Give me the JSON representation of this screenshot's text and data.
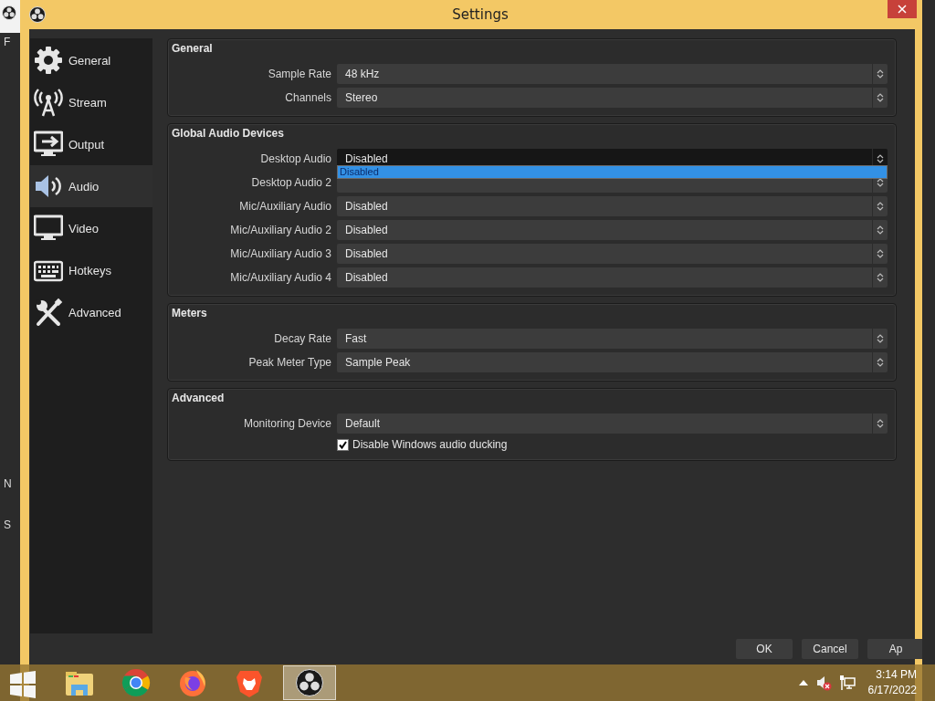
{
  "background_window": {
    "texts": [
      "F",
      "N",
      "S"
    ]
  },
  "window": {
    "title": "Settings"
  },
  "sidebar": {
    "items": [
      {
        "label": "General",
        "selected": false
      },
      {
        "label": "Stream",
        "selected": false
      },
      {
        "label": "Output",
        "selected": false
      },
      {
        "label": "Audio",
        "selected": true
      },
      {
        "label": "Video",
        "selected": false
      },
      {
        "label": "Hotkeys",
        "selected": false
      },
      {
        "label": "Advanced",
        "selected": false
      }
    ]
  },
  "groups": [
    {
      "title": "General",
      "rows": [
        {
          "kind": "combo",
          "label": "Sample Rate",
          "value": "48 kHz",
          "open": false
        },
        {
          "kind": "combo",
          "label": "Channels",
          "value": "Stereo",
          "open": false
        }
      ]
    },
    {
      "title": "Global Audio Devices",
      "rows": [
        {
          "kind": "combo",
          "label": "Desktop Audio",
          "value": "Disabled",
          "open": true,
          "options": [
            {
              "label": "Disabled",
              "selected": true
            }
          ]
        },
        {
          "kind": "combo",
          "label": "Desktop Audio 2",
          "open": false
        },
        {
          "kind": "combo",
          "label": "Mic/Auxiliary Audio",
          "value": "Disabled",
          "open": false
        },
        {
          "kind": "combo",
          "label": "Mic/Auxiliary Audio 2",
          "value": "Disabled",
          "open": false
        },
        {
          "kind": "combo",
          "label": "Mic/Auxiliary Audio 3",
          "value": "Disabled",
          "open": false
        },
        {
          "kind": "combo",
          "label": "Mic/Auxiliary Audio 4",
          "value": "Disabled",
          "open": false
        }
      ]
    },
    {
      "title": "Meters",
      "rows": [
        {
          "kind": "combo",
          "label": "Decay Rate",
          "value": "Fast",
          "open": false
        },
        {
          "kind": "combo",
          "label": "Peak Meter Type",
          "value": "Sample Peak",
          "open": false
        }
      ]
    },
    {
      "title": "Advanced",
      "rows": [
        {
          "kind": "combo",
          "label": "Monitoring Device",
          "value": "Default",
          "open": false
        },
        {
          "kind": "checkbox",
          "label": "Disable Windows audio ducking",
          "checked": true
        }
      ]
    }
  ],
  "buttons": [
    "OK",
    "Cancel",
    "Ap"
  ],
  "taskbar": {
    "items": [
      {
        "selected": false
      },
      {
        "selected": false
      },
      {
        "selected": false
      },
      {
        "selected": false
      },
      {
        "selected": false
      },
      {
        "selected": true
      }
    ]
  },
  "clock": {
    "time": "3:14 PM",
    "date": "6/17/2022"
  }
}
